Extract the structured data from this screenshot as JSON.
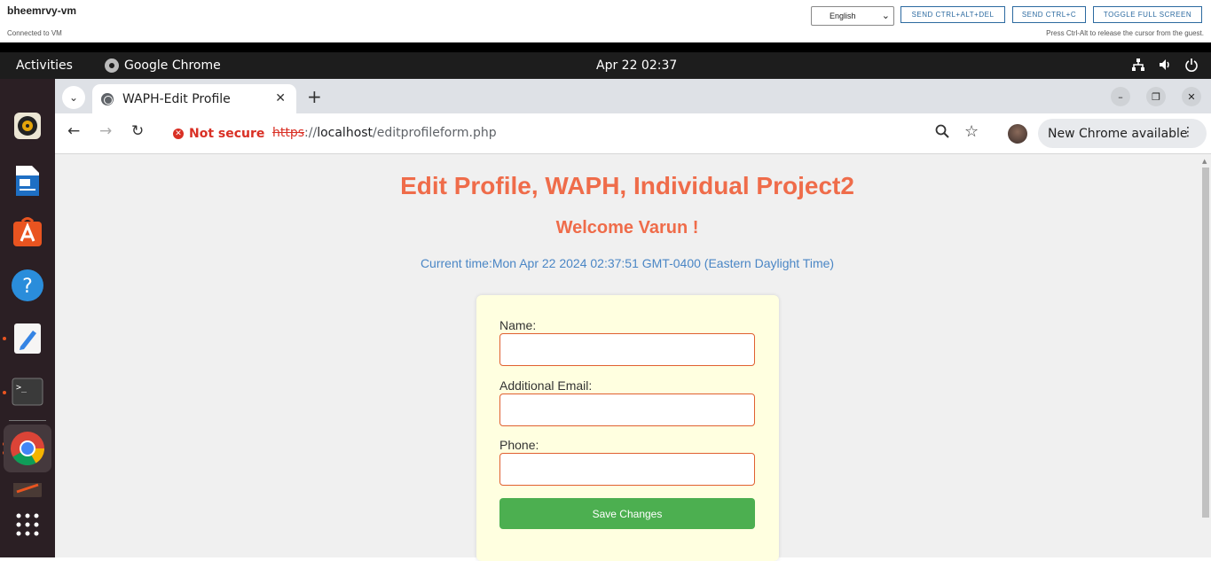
{
  "vm": {
    "name": "bheemrvy-vm",
    "status": "Connected to VM",
    "language": "English",
    "buttons": [
      "SEND CTRL+ALT+DEL",
      "SEND CTRL+C",
      "TOGGLE FULL SCREEN"
    ],
    "hint": "Press Ctrl-Alt to release the cursor from the guest."
  },
  "gnome": {
    "activities": "Activities",
    "app": "Google Chrome",
    "clock": "Apr 22  02:37",
    "tray_icons": [
      "network-icon",
      "volume-icon",
      "power-icon"
    ]
  },
  "dock": {
    "items": [
      "rhythmbox-icon",
      "writer-icon",
      "app-center-icon",
      "help-icon",
      "text-editor-icon",
      "terminal-icon",
      "chrome-icon",
      "files-icon",
      "show-apps-icon"
    ]
  },
  "browser": {
    "tab_title": "WAPH-Edit Profile",
    "security_label": "Not secure",
    "url_scheme": "https",
    "url_sep": "://",
    "url_host": "localhost",
    "url_path": "/editprofileform.php",
    "update_label": "New Chrome available"
  },
  "page": {
    "title": "Edit Profile, WAPH, Individual Project2",
    "welcome": "Welcome Varun !",
    "current_time": "Current time:Mon Apr 22 2024 02:37:51 GMT-0400 (Eastern Daylight Time)",
    "form": {
      "name_label": "Name:",
      "name_value": "",
      "email_label": "Additional Email:",
      "email_value": "",
      "phone_label": "Phone:",
      "phone_value": "",
      "submit_label": "Save Changes"
    }
  }
}
